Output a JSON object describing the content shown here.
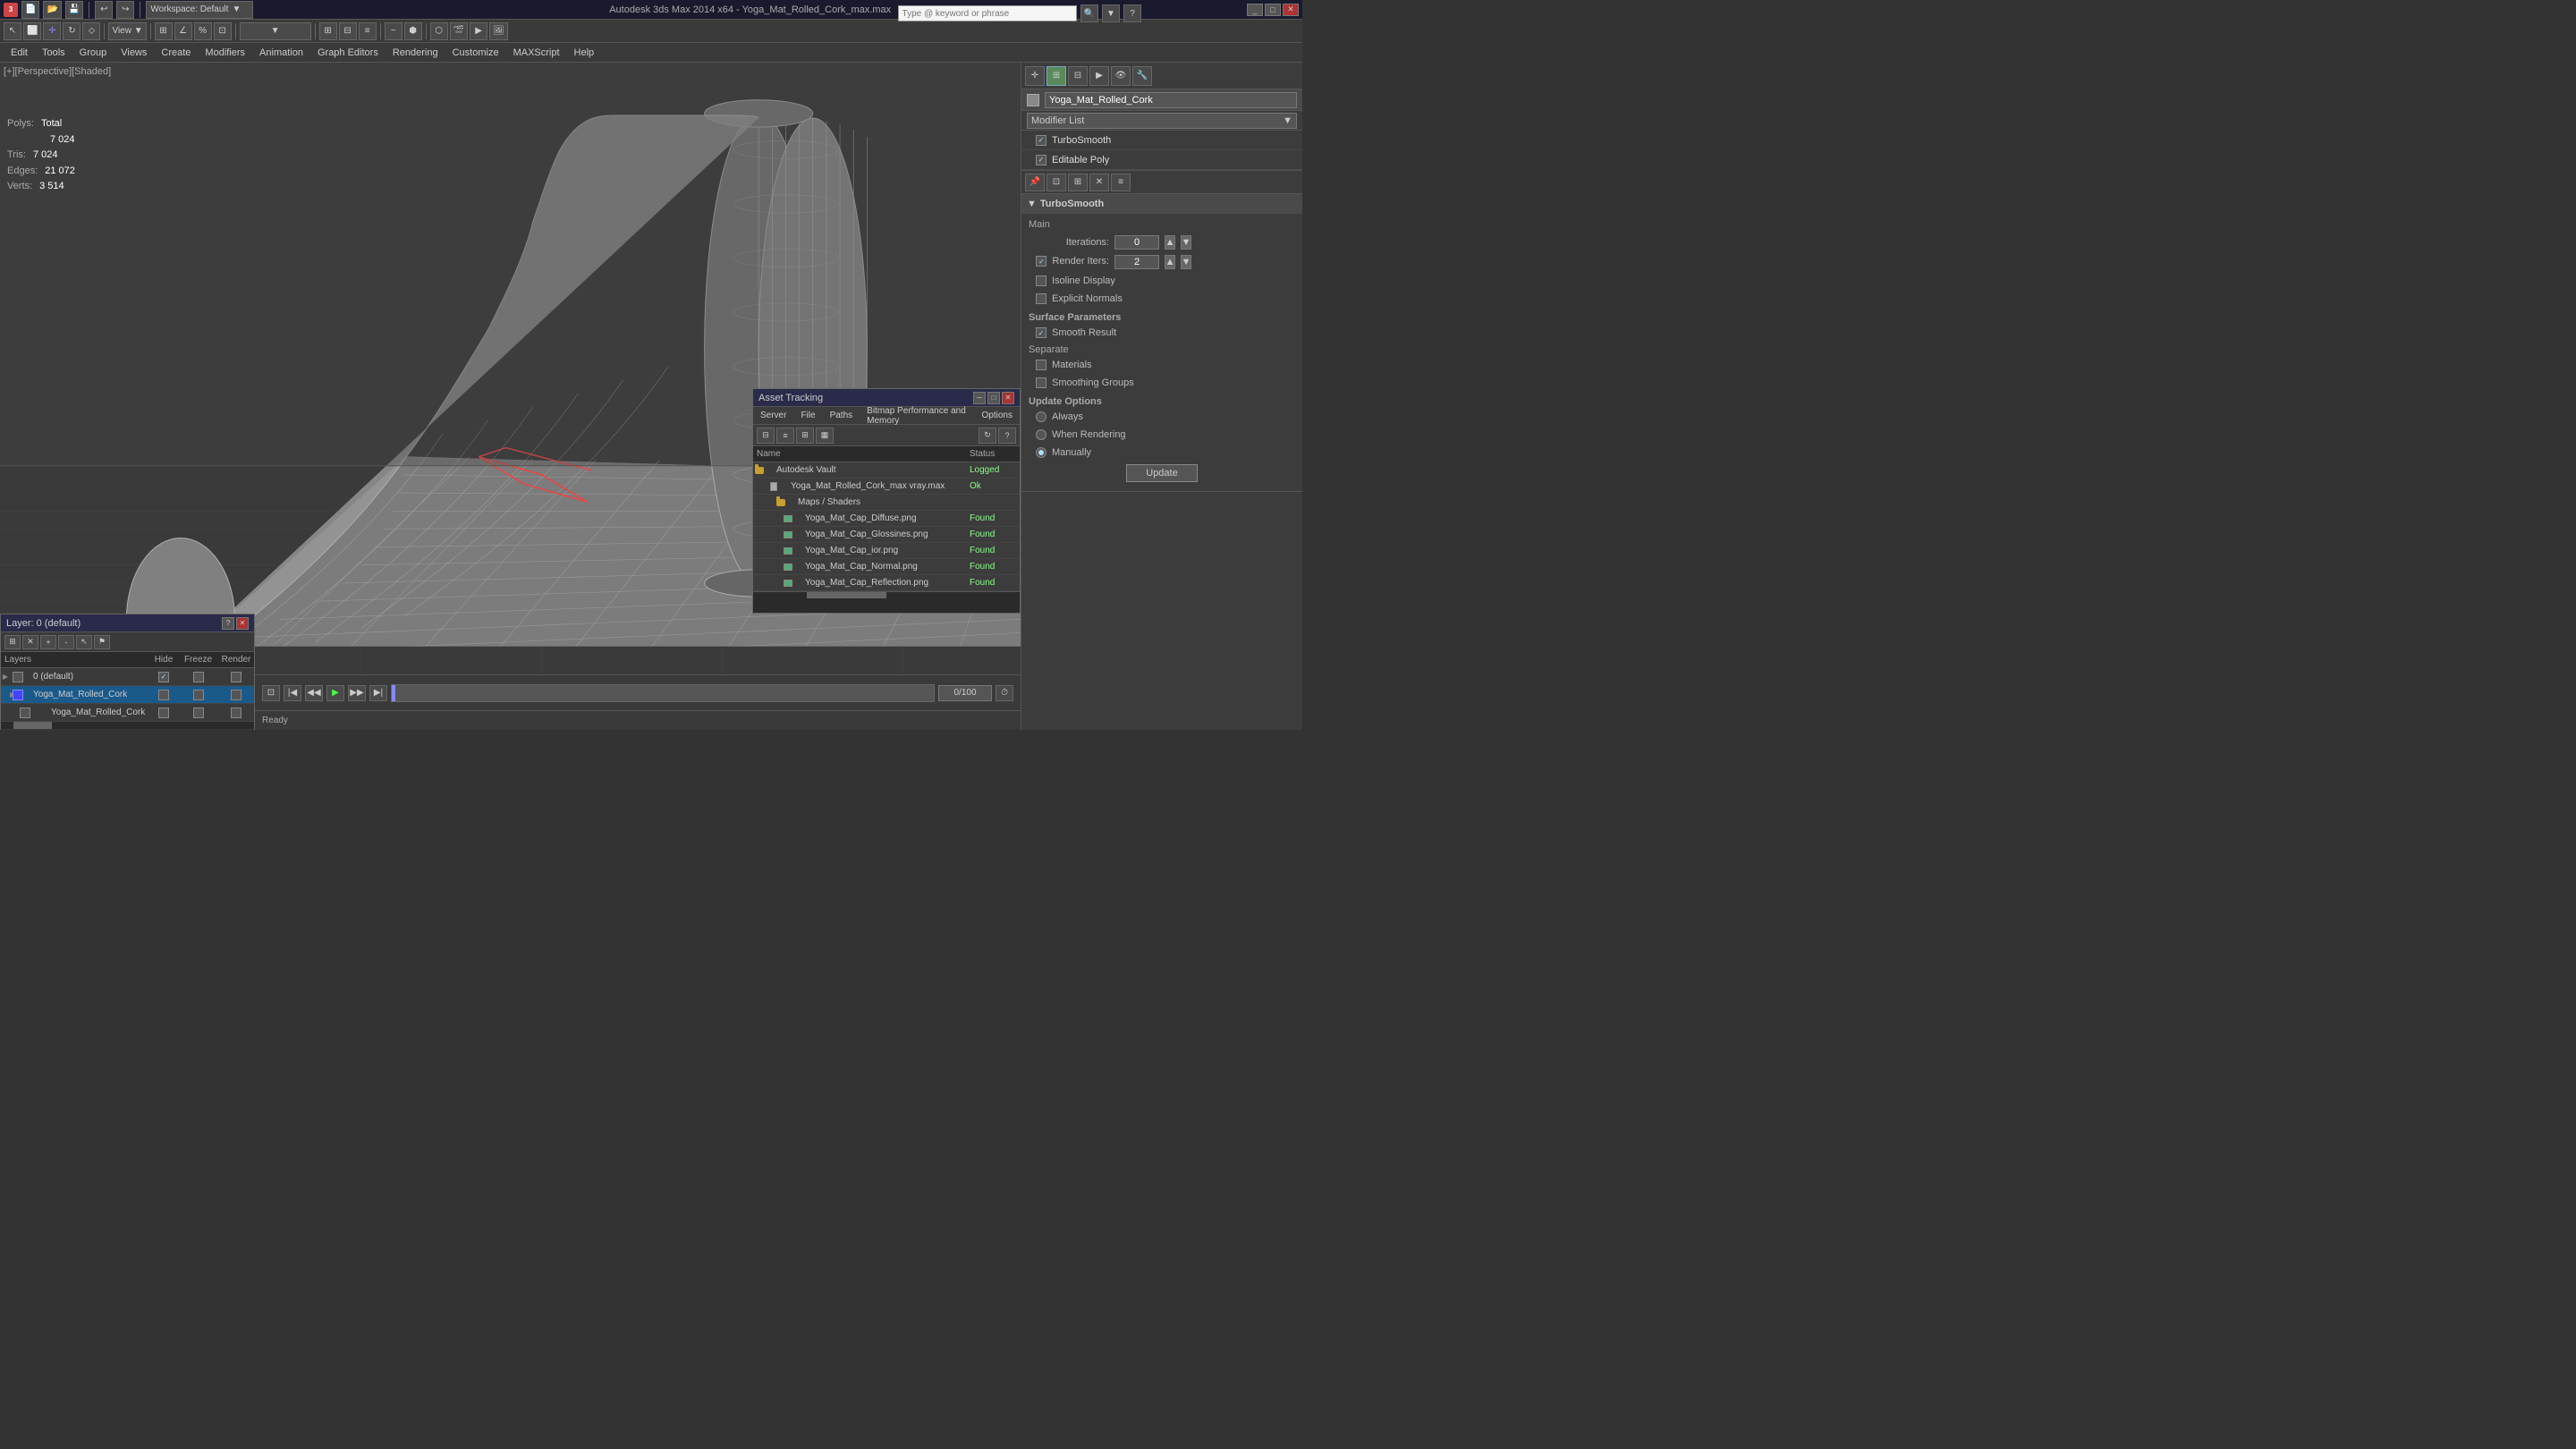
{
  "titlebar": {
    "title": "Autodesk 3ds Max 2014 x64 - Yoga_Mat_Rolled_Cork_max.max",
    "workspace": "Workspace: Default",
    "minimize": "_",
    "maximize": "□",
    "close": "✕"
  },
  "search": {
    "placeholder": "Type @ keyword or phrase"
  },
  "menubar": {
    "items": [
      "Edit",
      "Tools",
      "Group",
      "Views",
      "Create",
      "Modifiers",
      "Animation",
      "Graph Editors",
      "Rendering",
      "Customize",
      "MAXScript",
      "Help"
    ]
  },
  "viewport": {
    "label": "[+][Perspective][Shaded]",
    "stats": {
      "polys_label": "Polys:",
      "polys_total": "Total",
      "polys_value": "7 024",
      "tris_label": "Tris:",
      "tris_value": "7 024",
      "edges_label": "Edges:",
      "edges_value": "21 072",
      "verts_label": "Verts:",
      "verts_value": "3 514"
    }
  },
  "rightpanel": {
    "object_name": "Yoga_Mat_Rolled_Cork",
    "modifier_list_label": "Modifier List",
    "modifiers": [
      {
        "name": "TurboSmooth",
        "checked": true,
        "selected": false
      },
      {
        "name": "Editable Poly",
        "checked": true,
        "selected": false
      }
    ],
    "turbosmooth": {
      "section": "TurboSmooth",
      "main_label": "Main",
      "iterations_label": "Iterations:",
      "iterations_value": "0",
      "render_iters_label": "Render Iters:",
      "render_iters_value": "2",
      "isoline_display": "Isoline Display",
      "explicit_normals": "Explicit Normals",
      "surface_params": "Surface Parameters",
      "smooth_result": "Smooth Result",
      "smooth_result_checked": true,
      "separate": "Separate",
      "materials": "Materials",
      "smoothing_groups": "Smoothing Groups",
      "update_options": "Update Options",
      "always": "Always",
      "when_rendering": "When Rendering",
      "manually": "Manually",
      "manually_checked": true,
      "update_btn": "Update"
    }
  },
  "assetpanel": {
    "title": "Asset Tracking",
    "menu": [
      "Server",
      "File",
      "Paths",
      "Bitmap Performance and Memory",
      "Options"
    ],
    "columns": {
      "name": "Name",
      "status": "Status"
    },
    "rows": [
      {
        "indent": 0,
        "type": "folder",
        "name": "Autodesk Vault",
        "status": "Logged"
      },
      {
        "indent": 1,
        "type": "file",
        "name": "Yoga_Mat_Rolled_Cork_max vray.max",
        "status": "Ok"
      },
      {
        "indent": 2,
        "type": "folder",
        "name": "Maps / Shaders",
        "status": ""
      },
      {
        "indent": 3,
        "type": "img",
        "name": "Yoga_Mat_Cap_Diffuse.png",
        "status": "Found"
      },
      {
        "indent": 3,
        "type": "img",
        "name": "Yoga_Mat_Cap_Glossines.png",
        "status": "Found"
      },
      {
        "indent": 3,
        "type": "img",
        "name": "Yoga_Mat_Cap_ior.png",
        "status": "Found"
      },
      {
        "indent": 3,
        "type": "img",
        "name": "Yoga_Mat_Cap_Normal.png",
        "status": "Found"
      },
      {
        "indent": 3,
        "type": "img",
        "name": "Yoga_Mat_Cap_Reflection.png",
        "status": "Found"
      }
    ]
  },
  "layerspanel": {
    "title": "Layer: 0 (default)",
    "columns": {
      "name": "Layers",
      "hide": "Hide",
      "freeze": "Freeze",
      "render": "Render"
    },
    "rows": [
      {
        "name": "0 (default)",
        "selected": false,
        "hide": true,
        "freeze": false,
        "render": false,
        "children": [
          {
            "name": "Yoga_Mat_Rolled_Cork",
            "selected": true,
            "hide": false,
            "freeze": false,
            "render": false,
            "children": [
              {
                "name": "Yoga_Mat_Rolled_Cork",
                "selected": false,
                "hide": false,
                "freeze": false,
                "render": false
              }
            ]
          }
        ]
      }
    ]
  },
  "icons": {
    "chevron_down": "▼",
    "chevron_right": "▶",
    "check": "✓",
    "close": "✕",
    "minimize": "─",
    "maximize": "□",
    "folder": "📁",
    "pin": "📌",
    "question": "?",
    "lock": "🔒",
    "eye": "👁",
    "camera": "📷",
    "light": "💡",
    "helper": "⊕",
    "shapes": "△",
    "systems": "⚙",
    "undo": "↩",
    "redo": "↪"
  },
  "colors": {
    "accent_blue": "#2a5a8a",
    "accent_green": "#5a8a5a",
    "header_bg": "#1a1a2e",
    "panel_bg": "#3c3c3c",
    "toolbar_bg": "#3a3a3a",
    "border": "#555"
  }
}
